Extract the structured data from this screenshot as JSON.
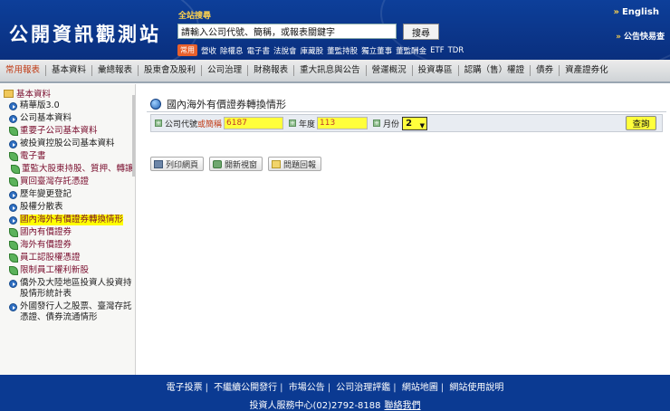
{
  "header": {
    "logo": "公開資訊觀測站",
    "search_label": "全站搜尋",
    "search_placeholder": "請輸入公司代號、簡稱，或報表關鍵字",
    "search_button": "搜尋",
    "quick_badge": "常用",
    "quick_links": [
      "營收",
      "除權息",
      "電子書",
      "法說會",
      "庫藏股",
      "董監持股",
      "獨立董事",
      "董監酬金",
      "ETF",
      "TDR"
    ],
    "english": "English",
    "quick_news": "公告快易查"
  },
  "nav": {
    "items": [
      "常用報表",
      "基本資料",
      "彙總報表",
      "股東會及股利",
      "公司治理",
      "財務報表",
      "重大訊息與公告",
      "營運概況",
      "投資專區",
      "認購（售）權證",
      "債券",
      "資產證券化"
    ],
    "active_index": 0
  },
  "sidebar": {
    "root": "基本資料",
    "items": [
      {
        "label": "精華版3.0",
        "icon": "dot",
        "level": 0,
        "pink": false
      },
      {
        "label": "公司基本資料",
        "icon": "dot",
        "level": 0,
        "pink": false
      },
      {
        "label": "重要子公司基本資料",
        "icon": "leaf",
        "level": 0,
        "pink": true
      },
      {
        "label": "被投資控股公司基本資料",
        "icon": "dot",
        "level": 0,
        "pink": false
      },
      {
        "label": "電子書",
        "icon": "leaf",
        "level": 0,
        "pink": true
      },
      {
        "label": "董監大股東持股、質押、轉讓",
        "icon": "leaf",
        "level": 1,
        "pink": true
      },
      {
        "label": "買回臺灣存託憑證",
        "icon": "leaf",
        "level": 0,
        "pink": true
      },
      {
        "label": "歷年變更登記",
        "icon": "dot",
        "level": 0,
        "pink": false
      },
      {
        "label": "股權分散表",
        "icon": "dot",
        "level": 0,
        "pink": false
      },
      {
        "label": "國內海外有價證券轉換情形",
        "icon": "dot",
        "level": 0,
        "pink": true,
        "highlight": true
      },
      {
        "label": "國內有價證券",
        "icon": "leaf",
        "level": 0,
        "pink": true
      },
      {
        "label": "海外有價證券",
        "icon": "leaf",
        "level": 0,
        "pink": true
      },
      {
        "label": "員工認股權憑證",
        "icon": "leaf",
        "level": 0,
        "pink": true
      },
      {
        "label": "限制員工權利新股",
        "icon": "leaf",
        "level": 0,
        "pink": true
      },
      {
        "label": "僑外及大陸地區投資人投資持股情形統計表",
        "icon": "dot",
        "level": 0,
        "pink": false
      },
      {
        "label": "外國發行人之股票、臺灣存託憑證、債券流通情形",
        "icon": "dot",
        "level": 0,
        "pink": false
      }
    ]
  },
  "main": {
    "title": "國內海外有價證券轉換情形",
    "query": {
      "company_label": "公司代號",
      "company_label_or": "或簡稱",
      "company_value": "6187",
      "year_label": "年度",
      "year_value": "113",
      "month_label": "月份",
      "month_value": "2",
      "submit": "查詢"
    },
    "tools": {
      "print": "列印網頁",
      "new_window": "開新視窗",
      "feedback": "問題回報"
    }
  },
  "footer": {
    "links": [
      "電子投票",
      "不繼續公開發行",
      "市場公告",
      "公司治理評鑑",
      "網站地圖",
      "網站使用說明"
    ],
    "contact": "投資人服務中心(02)2792-8188",
    "contact_link": "聯絡我們"
  },
  "colors": {
    "header_blue": "#0d3f9a",
    "accent_orange": "#c03a14",
    "highlight_yellow": "#ffff3c"
  }
}
